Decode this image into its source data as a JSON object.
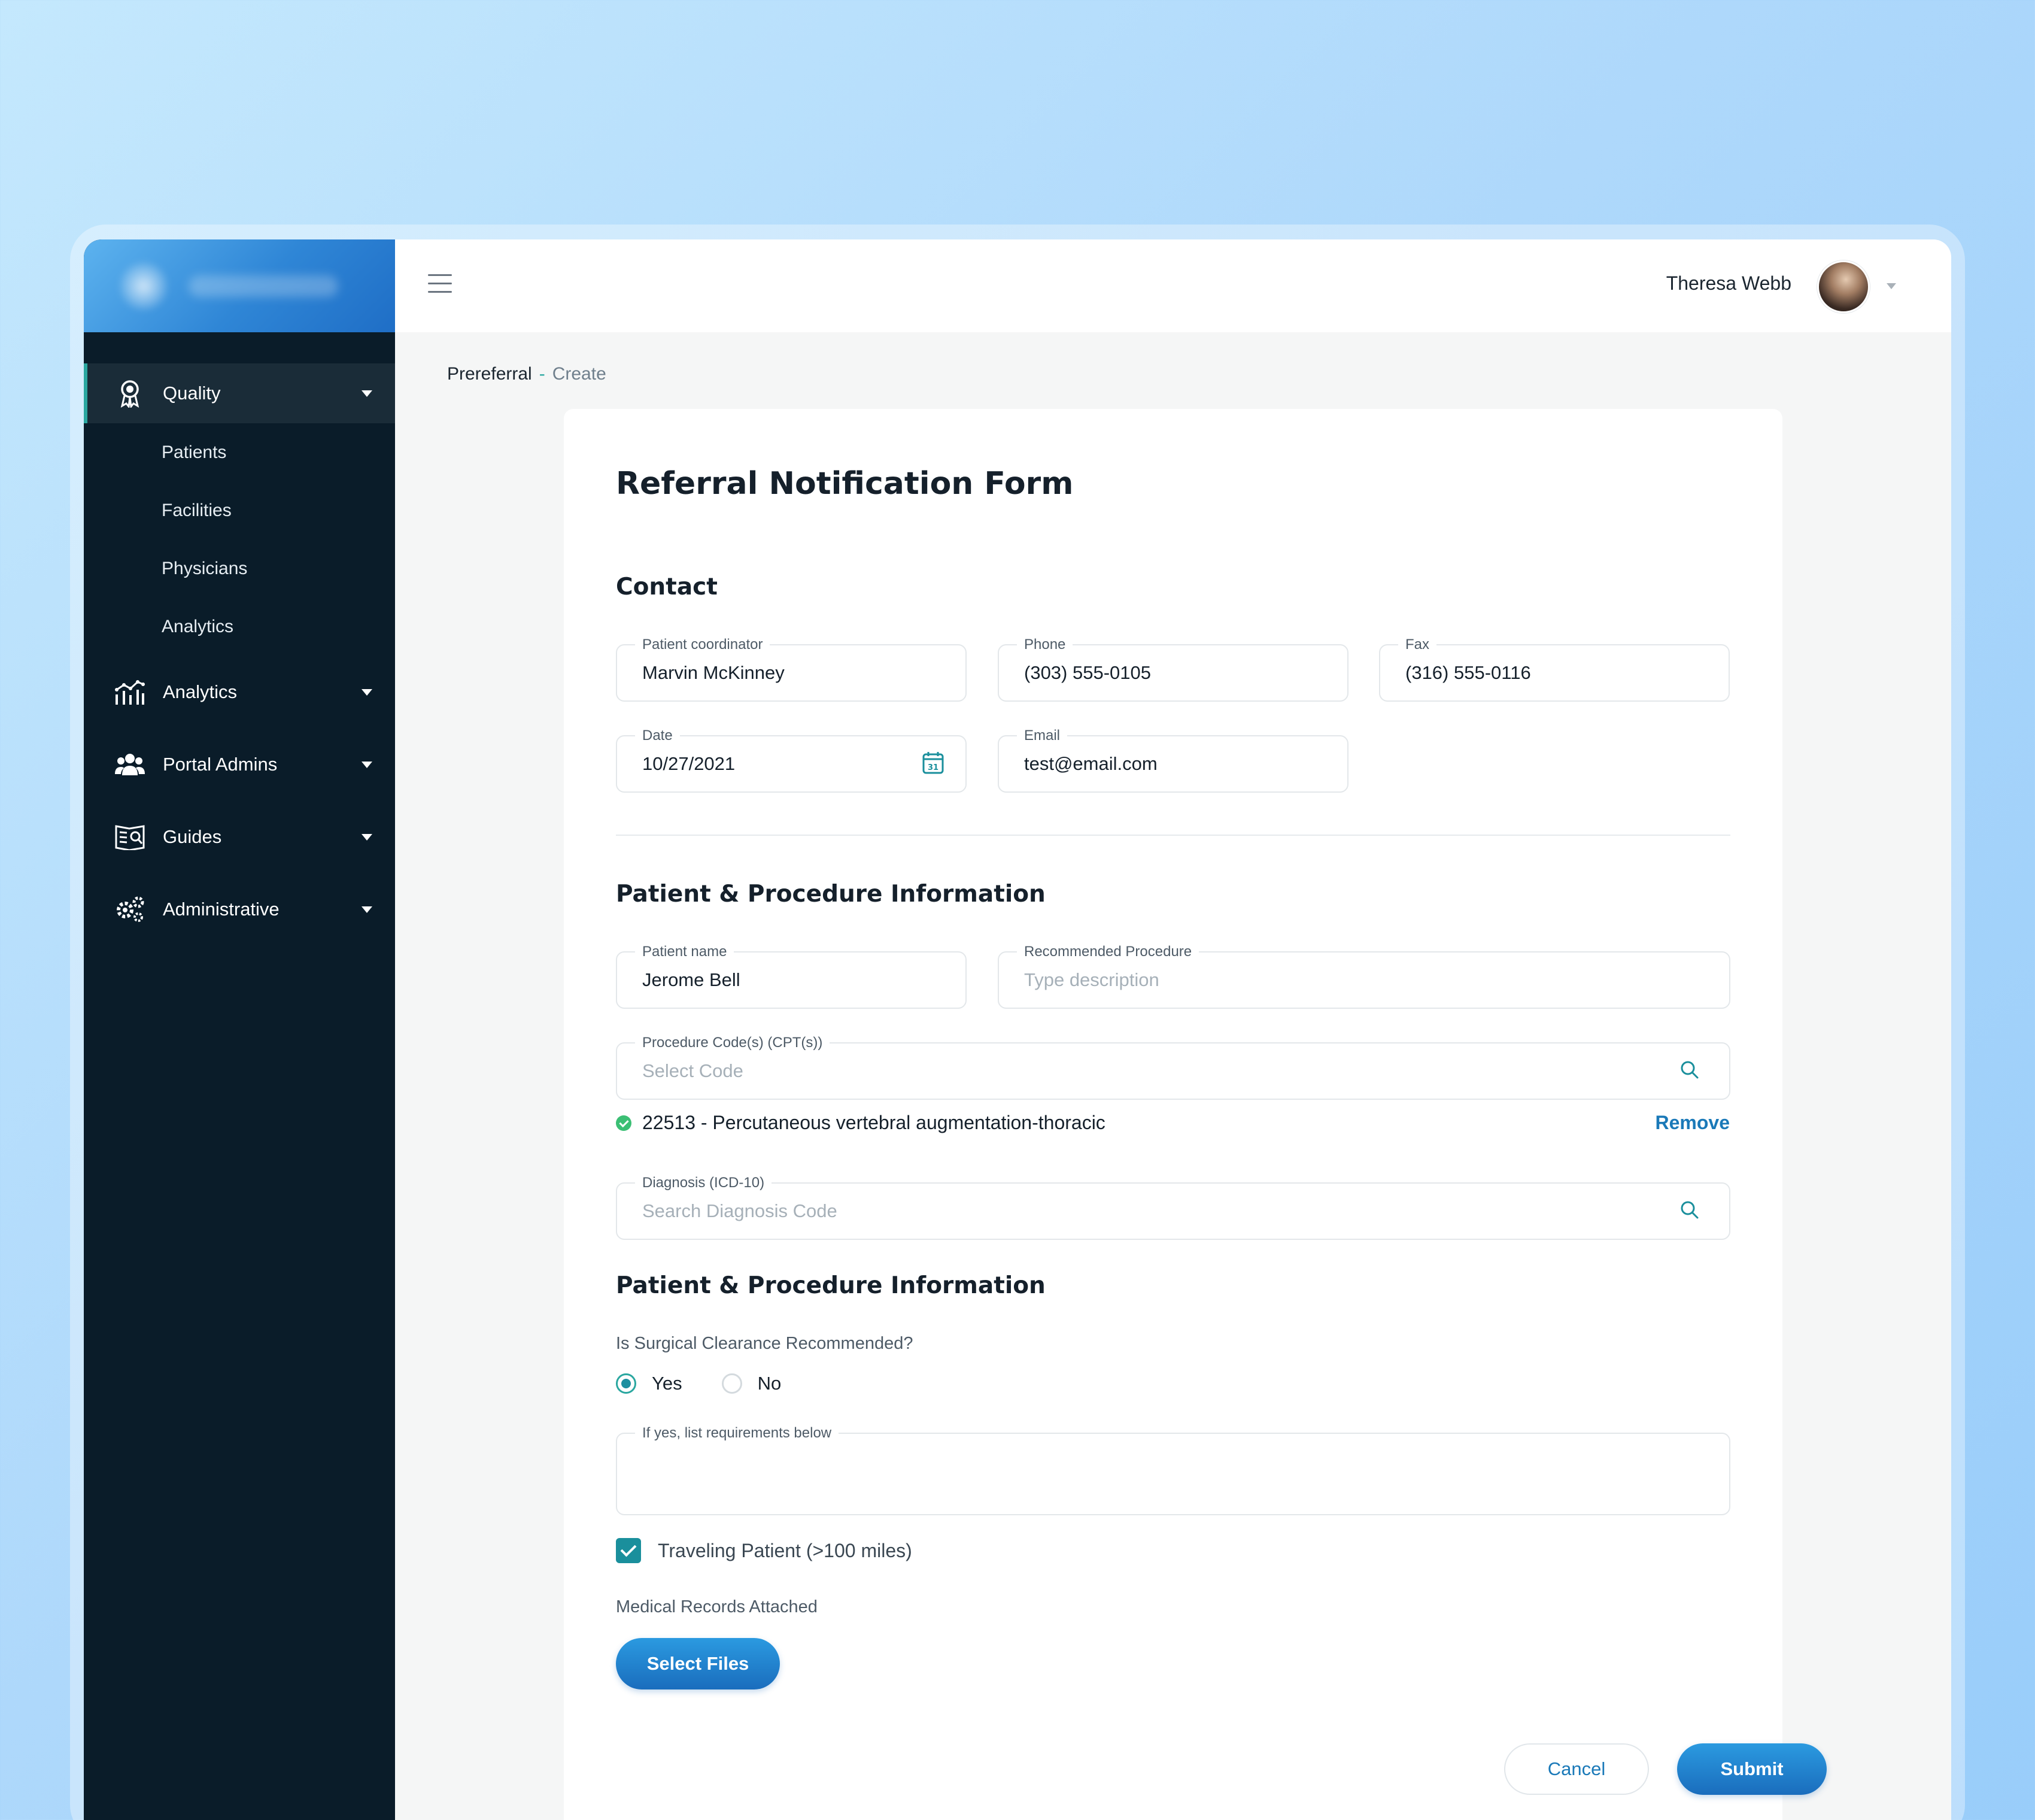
{
  "user": {
    "name": "Theresa Webb"
  },
  "sidebar": {
    "quality": {
      "label": "Quality",
      "sub_items": [
        "Patients",
        "Facilities",
        "Physicians",
        "Analytics"
      ]
    },
    "groups": [
      {
        "label": "Analytics",
        "icon": "analytics-icon"
      },
      {
        "label": "Portal Admins",
        "icon": "users-icon"
      },
      {
        "label": "Guides",
        "icon": "guide-icon"
      },
      {
        "label": "Administrative",
        "icon": "gears-icon"
      }
    ]
  },
  "breadcrumb": {
    "parent": "Prereferral",
    "separator": "-",
    "current": "Create"
  },
  "form": {
    "title": "Referral Notification Form",
    "contact": {
      "heading": "Contact",
      "coordinator": {
        "label": "Patient coordinator",
        "value": "Marvin McKinney"
      },
      "phone": {
        "label": "Phone",
        "value": "(303) 555-0105"
      },
      "fax": {
        "label": "Fax",
        "value": "(316) 555-0116"
      },
      "date": {
        "label": "Date",
        "value": "10/27/2021"
      },
      "email": {
        "label": "Email",
        "value": "test@email.com"
      }
    },
    "patient_procedure": {
      "heading": "Patient & Procedure Information",
      "patient_name": {
        "label": "Patient name",
        "value": "Jerome Bell"
      },
      "recommended_procedure": {
        "label": "Recommended Procedure",
        "placeholder": "Type description"
      },
      "procedure_codes": {
        "label": "Procedure Code(s) (CPT(s))",
        "placeholder": "Select Code"
      },
      "selected_code": "22513 - Percutaneous vertebral augmentation-thoracic",
      "remove_label": "Remove",
      "diagnosis": {
        "label": "Diagnosis (ICD-10)",
        "placeholder": "Search Diagnosis Code"
      }
    },
    "clearance": {
      "heading": "Patient & Procedure Information",
      "question": "Is Surgical Clearance Recommended?",
      "options": [
        "Yes",
        "No"
      ],
      "selected": "Yes",
      "requirements_label": "If yes, list requirements below",
      "requirements_value": "",
      "traveling_label": "Traveling Patient (>100 miles)",
      "traveling_checked": true,
      "records_label": "Medical Records Attached",
      "select_files_label": "Select Files"
    },
    "actions": {
      "cancel": "Cancel",
      "submit": "Submit"
    }
  },
  "colors": {
    "sidebar_bg": "#0a1c29",
    "accent": "#1a79b8",
    "teal": "#2aa7a0",
    "success": "#3bbf74"
  }
}
